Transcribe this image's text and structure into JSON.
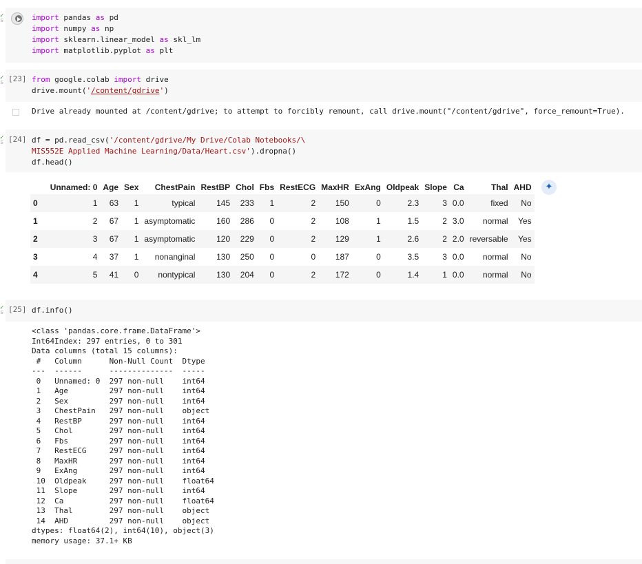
{
  "cells": [
    {
      "exec_label": "",
      "lines": [
        [
          [
            "kw",
            "import"
          ],
          [
            "t",
            " pandas "
          ],
          [
            "kw",
            "as"
          ],
          [
            "t",
            " pd"
          ]
        ],
        [
          [
            "kw",
            "import"
          ],
          [
            "t",
            " numpy "
          ],
          [
            "kw",
            "as"
          ],
          [
            "t",
            " np"
          ]
        ],
        [
          [
            "kw",
            "import"
          ],
          [
            "t",
            " sklearn.linear_model "
          ],
          [
            "kw",
            "as"
          ],
          [
            "t",
            " skl_lm"
          ]
        ],
        [
          [
            "kw",
            "import"
          ],
          [
            "t",
            " matplotlib.pyplot "
          ],
          [
            "kw",
            "as"
          ],
          [
            "t",
            " plt"
          ]
        ]
      ]
    },
    {
      "exec_label": "[23]",
      "lines": [
        [
          [
            "kw",
            "from"
          ],
          [
            "t",
            " google.colab "
          ],
          [
            "kw",
            "import"
          ],
          [
            "t",
            " drive"
          ]
        ],
        [
          [
            "t",
            "drive.mount("
          ],
          [
            "str",
            "'"
          ],
          [
            "link",
            "/content/gdrive"
          ],
          [
            "str",
            "'"
          ],
          [
            "t",
            ")"
          ]
        ]
      ],
      "output": "Drive already mounted at /content/gdrive; to attempt to forcibly remount, call drive.mount(\"/content/gdrive\", force_remount=True)."
    },
    {
      "exec_label": "[24]",
      "lines": [
        [
          [
            "t",
            "df = pd.read_csv("
          ],
          [
            "str",
            "'/content/gdrive/My Drive/Colab Notebooks/\\"
          ]
        ],
        [
          [
            "str",
            "MIS552E Applied Machine Learning/Data/Heart.csv'"
          ],
          [
            "t",
            ").dropna()"
          ]
        ],
        [
          [
            "t",
            "df.head()"
          ]
        ]
      ]
    },
    {
      "exec_label": "[25]",
      "lines": [
        [
          [
            "t",
            "df.info()"
          ]
        ]
      ]
    }
  ],
  "dataframe": {
    "columns": [
      "",
      "Unnamed: 0",
      "Age",
      "Sex",
      "ChestPain",
      "RestBP",
      "Chol",
      "Fbs",
      "RestECG",
      "MaxHR",
      "ExAng",
      "Oldpeak",
      "Slope",
      "Ca",
      "Thal",
      "AHD"
    ],
    "rows": [
      [
        "0",
        "1",
        "63",
        "1",
        "typical",
        "145",
        "233",
        "1",
        "2",
        "150",
        "0",
        "2.3",
        "3",
        "0.0",
        "fixed",
        "No"
      ],
      [
        "1",
        "2",
        "67",
        "1",
        "asymptomatic",
        "160",
        "286",
        "0",
        "2",
        "108",
        "1",
        "1.5",
        "2",
        "3.0",
        "normal",
        "Yes"
      ],
      [
        "2",
        "3",
        "67",
        "1",
        "asymptomatic",
        "120",
        "229",
        "0",
        "2",
        "129",
        "1",
        "2.6",
        "2",
        "2.0",
        "reversable",
        "Yes"
      ],
      [
        "3",
        "4",
        "37",
        "1",
        "nonanginal",
        "130",
        "250",
        "0",
        "0",
        "187",
        "0",
        "3.5",
        "3",
        "0.0",
        "normal",
        "No"
      ],
      [
        "4",
        "5",
        "41",
        "0",
        "nontypical",
        "130",
        "204",
        "0",
        "2",
        "172",
        "0",
        "1.4",
        "1",
        "0.0",
        "normal",
        "No"
      ]
    ]
  },
  "info_output": [
    "<class 'pandas.core.frame.DataFrame'>",
    "Int64Index: 297 entries, 0 to 301",
    "Data columns (total 15 columns):",
    " #   Column      Non-Null Count  Dtype  ",
    "---  ------      --------------  -----  ",
    " 0   Unnamed: 0  297 non-null    int64  ",
    " 1   Age         297 non-null    int64  ",
    " 2   Sex         297 non-null    int64  ",
    " 3   ChestPain   297 non-null    object ",
    " 4   RestBP      297 non-null    int64  ",
    " 5   Chol        297 non-null    int64  ",
    " 6   Fbs         297 non-null    int64  ",
    " 7   RestECG     297 non-null    int64  ",
    " 8   MaxHR       297 non-null    int64  ",
    " 9   ExAng       297 non-null    int64  ",
    " 10  Oldpeak     297 non-null    float64",
    " 11  Slope       297 non-null    int64  ",
    " 12  Ca          297 non-null    float64",
    " 13  Thal        297 non-null    object ",
    " 14  AHD         297 non-null    object ",
    "dtypes: float64(2), int64(10), object(3)",
    "memory usage: 37.1+ KB"
  ],
  "icons": {
    "run": "play-circle-icon",
    "magic": "magic-wand-icon",
    "output": "output-icon",
    "status": "checkmark-icon"
  },
  "colors": {
    "keyword": "#af00db",
    "string": "#a31515",
    "cell_bg": "#f7f7f7"
  }
}
